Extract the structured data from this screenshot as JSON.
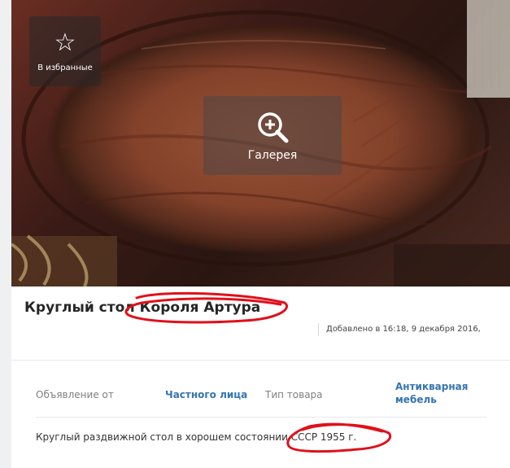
{
  "photo": {
    "favorite_label": "В избранные",
    "favorite_icon": "star-icon",
    "gallery_label": "Галерея",
    "gallery_icon": "zoom-in-icon"
  },
  "listing": {
    "title": "Круглый стол Короля Артура",
    "added": "Добавлено в 16:18, 9 декабря 2016,",
    "params": [
      {
        "label": "Объявление от",
        "value": "Частного лица"
      },
      {
        "label": "Тип товара",
        "value_line1": "Антикварная",
        "value_line2": "мебель"
      }
    ],
    "description": "Круглый раздвижной стол в хорошем состоянии СССР 1955 г."
  },
  "colors": {
    "link": "#3474b0",
    "scribble": "#e0101a"
  }
}
